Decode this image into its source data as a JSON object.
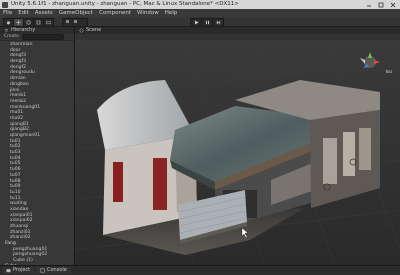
{
  "window": {
    "title": "Unity 5.6.1f1 - zhanguan.unity - zhanguan - PC, Mac & Linux Standalone* <DX11>"
  },
  "menubar": {
    "items": [
      "File",
      "Edit",
      "Assets",
      "GameObject",
      "Component",
      "Window",
      "Help"
    ]
  },
  "toolbar": {
    "tools": [
      "hand-tool-icon",
      "move-tool-icon",
      "rotate-tool-icon",
      "scale-tool-icon",
      "rect-tool-icon"
    ],
    "play_controls": [
      "play-icon",
      "pause-icon",
      "step-icon"
    ]
  },
  "hierarchy": {
    "tab_label": "Hierarchy",
    "create_label": "Create",
    "rows": [
      {
        "label": "shanmian",
        "kind": "item"
      },
      {
        "label": "door",
        "kind": "item"
      },
      {
        "label": "dengf3",
        "kind": "item"
      },
      {
        "label": "dengf3",
        "kind": "item"
      },
      {
        "label": "dengf2",
        "kind": "item"
      },
      {
        "label": "dengroudu",
        "kind": "item"
      },
      {
        "label": "dimian",
        "kind": "item"
      },
      {
        "label": "dingban",
        "kind": "item"
      },
      {
        "label": "jieni",
        "kind": "item"
      },
      {
        "label": "menb1",
        "kind": "item"
      },
      {
        "label": "menb2",
        "kind": "item"
      },
      {
        "label": "menkuang01",
        "kind": "item"
      },
      {
        "label": "mu01",
        "kind": "item"
      },
      {
        "label": "mu02",
        "kind": "item"
      },
      {
        "label": "qiangB1",
        "kind": "item"
      },
      {
        "label": "qiangB2",
        "kind": "item"
      },
      {
        "label": "qiangmian01",
        "kind": "item"
      },
      {
        "label": "tu01",
        "kind": "item"
      },
      {
        "label": "tu02",
        "kind": "item"
      },
      {
        "label": "tu03",
        "kind": "item"
      },
      {
        "label": "tu04",
        "kind": "item"
      },
      {
        "label": "tu05",
        "kind": "item"
      },
      {
        "label": "tu06",
        "kind": "item"
      },
      {
        "label": "tu07",
        "kind": "item"
      },
      {
        "label": "tu08",
        "kind": "item"
      },
      {
        "label": "tu09",
        "kind": "item"
      },
      {
        "label": "tu10",
        "kind": "item"
      },
      {
        "label": "tu11",
        "kind": "item"
      },
      {
        "label": "wuding",
        "kind": "item"
      },
      {
        "label": "xiandao",
        "kind": "item"
      },
      {
        "label": "xianpai01",
        "kind": "item"
      },
      {
        "label": "xianpai02",
        "kind": "item"
      },
      {
        "label": "zhuanqi",
        "kind": "item"
      },
      {
        "label": "zhanzi01",
        "kind": "item"
      },
      {
        "label": "zhanzi02",
        "kind": "item"
      },
      {
        "label": "Fang",
        "kind": "group"
      },
      {
        "label": "pengzhuang01",
        "kind": "item2"
      },
      {
        "label": "pengzhuang02",
        "kind": "item2"
      },
      {
        "label": "Cube (1)",
        "kind": "item2"
      },
      {
        "label": "Cube",
        "kind": "group"
      },
      {
        "label": "Camera",
        "kind": "item2"
      }
    ]
  },
  "scene": {
    "tab_label": "Scene",
    "gizmo_label": "Iso"
  },
  "bottom": {
    "project_label": "Project",
    "console_label": "Console"
  }
}
